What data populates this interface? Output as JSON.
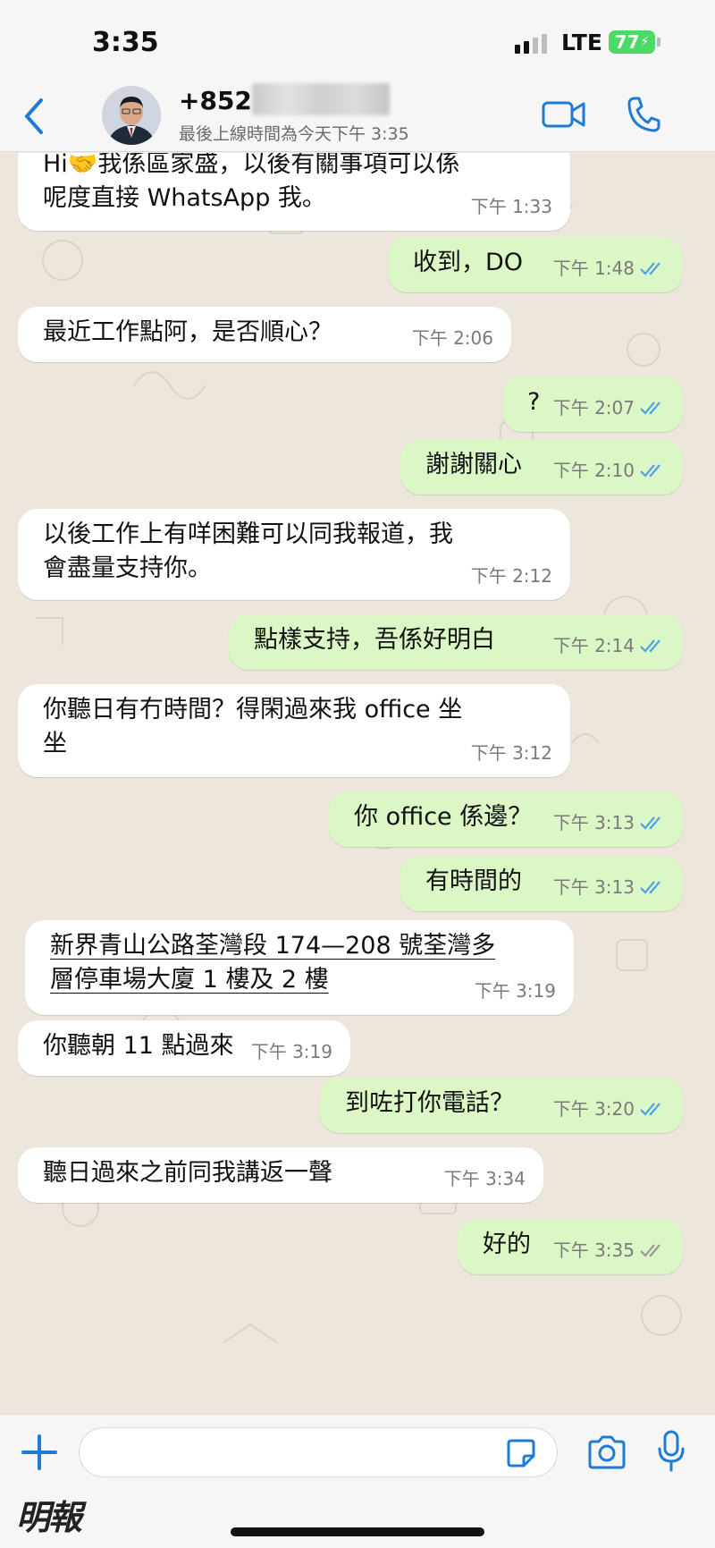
{
  "status_bar": {
    "time": "3:35",
    "network": "LTE",
    "battery": "77"
  },
  "header": {
    "contact_number": "+852",
    "last_seen": "最後上線時間為今天下午 3:35"
  },
  "messages": [
    {
      "direction": "in",
      "text": "Hi🤝我係區家盛，以後有關事項可以係\n呢度直接 WhatsApp 我。",
      "time": "下午 1:33"
    },
    {
      "direction": "out",
      "text": "收到，DO",
      "time": "下午 1:48",
      "status": "read"
    },
    {
      "direction": "in",
      "text": "最近工作點阿，是否順心？",
      "time": "下午 2:06"
    },
    {
      "direction": "out",
      "text": "?",
      "time": "下午 2:07",
      "status": "read"
    },
    {
      "direction": "out",
      "text": "謝謝關心",
      "time": "下午 2:10",
      "status": "read"
    },
    {
      "direction": "in",
      "text": "以後工作上有咩困難可以同我報道，我\n會盡量支持你。",
      "time": "下午 2:12"
    },
    {
      "direction": "out",
      "text": "點樣支持，吾係好明白",
      "time": "下午 2:14",
      "status": "read"
    },
    {
      "direction": "in",
      "text": "你聽日有冇時間？得閑過來我 office 坐\n坐",
      "time": "下午 3:12"
    },
    {
      "direction": "out",
      "text": "你 office 係邊？",
      "time": "下午 3:13",
      "status": "read"
    },
    {
      "direction": "out",
      "text": "有時間的",
      "time": "下午 3:13",
      "status": "read"
    },
    {
      "direction": "in",
      "text": "新界青山公路荃灣段 174—208 號荃灣多\n層停車場大廈 1 樓及 2 樓",
      "time": "下午 3:19"
    },
    {
      "direction": "in",
      "text": "你聽朝 11 點過來",
      "time": "下午 3:19"
    },
    {
      "direction": "out",
      "text": "到咗打你電話？",
      "time": "下午 3:20",
      "status": "read"
    },
    {
      "direction": "in",
      "text": "聽日過來之前同我講返一聲",
      "time": "下午 3:34"
    },
    {
      "direction": "out",
      "text": "好的",
      "time": "下午 3:35",
      "status": "delivered"
    }
  ],
  "input": {
    "placeholder": ""
  },
  "watermark": "明報",
  "colors": {
    "accent": "#1e7cd6",
    "read_ticks": "#4fa3e6",
    "delivered_ticks": "#9a9a9a",
    "outgoing_bubble": "#dbf7c6",
    "incoming_bubble": "#ffffff",
    "chat_background": "#ece6dc"
  }
}
